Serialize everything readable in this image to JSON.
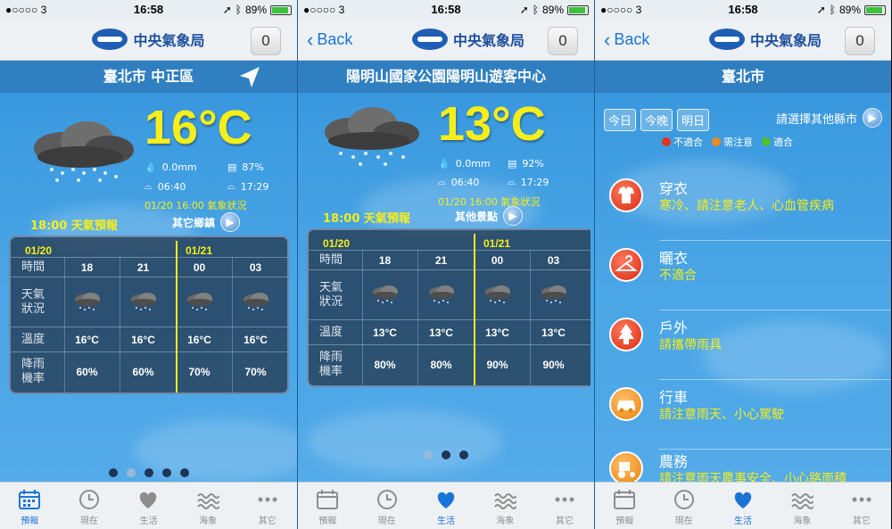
{
  "status": {
    "carrier": "●○○○○ 3",
    "time": "16:58",
    "battery": "89%"
  },
  "header": {
    "logo_text": "中央氣象局",
    "badge": "0",
    "back_label": "Back"
  },
  "screen1": {
    "location": "臺北市 中正區",
    "temperature": "16°C",
    "rain": "0.0mm",
    "humidity": "87%",
    "sunrise": "06:40",
    "sunset": "17:29",
    "obs_time": "01/20 16:00 氣象狀況",
    "forecast_label": "18:00 天氣預報",
    "other_link": "其它鄉鎮",
    "date1": "01/20",
    "date2": "01/21",
    "row_labels": {
      "time": "時間",
      "weather": "天氣\n狀況",
      "temp": "溫度",
      "pop": "降雨\n機率"
    },
    "hours": [
      "18",
      "21",
      "00",
      "03"
    ],
    "temps": [
      "16°C",
      "16°C",
      "16°C",
      "16°C"
    ],
    "pops": [
      "60%",
      "60%",
      "70%",
      "70%"
    ]
  },
  "screen2": {
    "location": "陽明山國家公園陽明山遊客中心",
    "temperature": "13°C",
    "rain": "0.0mm",
    "humidity": "92%",
    "sunrise": "06:40",
    "sunset": "17:29",
    "obs_time": "01/20 16:00 氣象狀況",
    "forecast_label": "18:00 天氣預報",
    "other_link": "其他景點",
    "date1": "01/20",
    "date2": "01/21",
    "hours": [
      "18",
      "21",
      "00",
      "03"
    ],
    "temps": [
      "13°C",
      "13°C",
      "13°C",
      "13°C"
    ],
    "pops": [
      "80%",
      "80%",
      "90%",
      "90%"
    ]
  },
  "screen3": {
    "location": "臺北市",
    "day_buttons": [
      "今日",
      "今晚",
      "明日"
    ],
    "select_county": "請選擇其他縣市",
    "legend": [
      {
        "label": "不適合",
        "color": "#e8321e"
      },
      {
        "label": "需注意",
        "color": "#f08a18"
      },
      {
        "label": "適合",
        "color": "#52c02c"
      }
    ],
    "items": [
      {
        "title": "穿衣",
        "desc": "寒冷、請注意老人、心血管疾病",
        "icon": "clothes-icon"
      },
      {
        "title": "曬衣",
        "desc": "不適合",
        "icon": "hanger-icon"
      },
      {
        "title": "戶外",
        "desc": "請攜帶雨具",
        "icon": "tree-icon"
      },
      {
        "title": "行車",
        "desc": "請注意雨天、小心駕駛",
        "icon": "car-icon"
      },
      {
        "title": "農務",
        "desc": "請注意雨天農事安全、小心路面積",
        "icon": "tractor-icon"
      }
    ]
  },
  "tabs": [
    "預報",
    "現在",
    "生活",
    "海象",
    "其它"
  ],
  "colors": {
    "accent": "#1a74d8",
    "yellow": "#f5ee1a"
  }
}
